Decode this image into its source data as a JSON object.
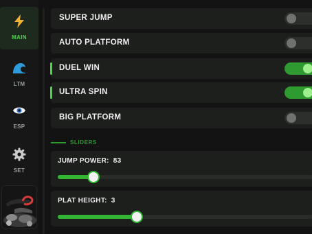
{
  "sidebar": {
    "items": [
      {
        "label": "MAIN",
        "icon": "lightning-icon",
        "active": true
      },
      {
        "label": "LTM",
        "icon": "wave-icon",
        "active": false
      },
      {
        "label": "ESP",
        "icon": "eye-icon",
        "active": false
      },
      {
        "label": "SET",
        "icon": "gear-icon",
        "active": false
      }
    ]
  },
  "toggles": [
    {
      "label": "SUPER JUMP",
      "on": false
    },
    {
      "label": "AUTO PLATFORM",
      "on": false
    },
    {
      "label": "DUEL WIN",
      "on": true
    },
    {
      "label": "ULTRA SPIN",
      "on": true
    },
    {
      "label": "BIG PLATFORM",
      "on": false
    }
  ],
  "sliders_section": {
    "title": "SLIDERS",
    "items": [
      {
        "label": "JUMP POWER:",
        "value": "83",
        "fraction": 0.14
      },
      {
        "label": "PLAT HEIGHT:",
        "value": "3",
        "fraction": 0.31
      }
    ]
  },
  "colors": {
    "accent": "#49d649",
    "switch_on": "#2f9a2f",
    "background": "#131313"
  }
}
